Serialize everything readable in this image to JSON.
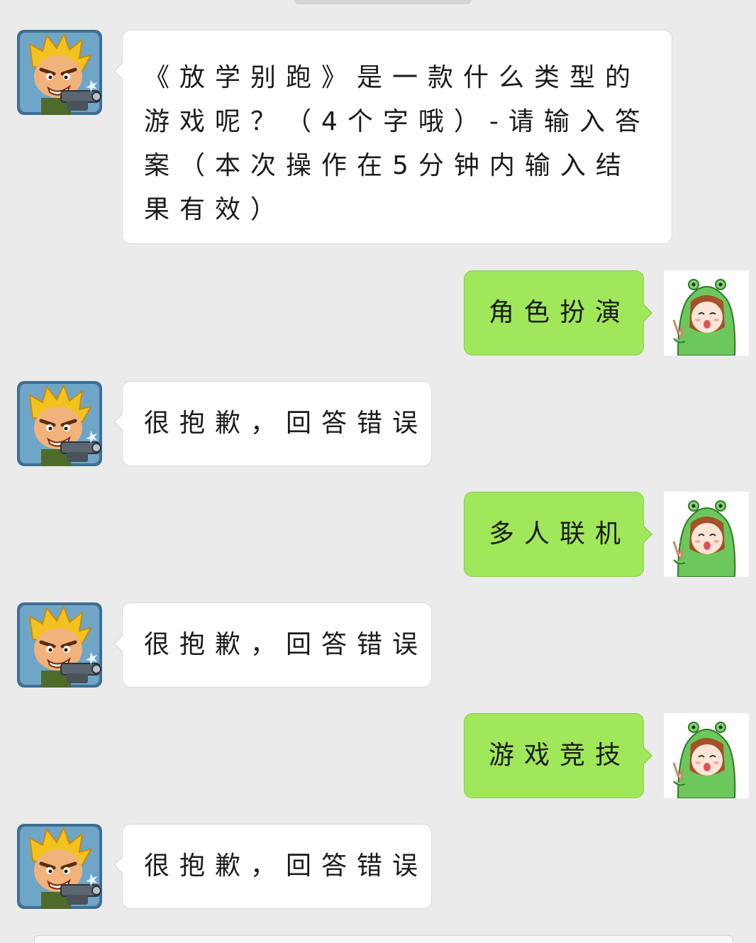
{
  "messages": [
    {
      "from": "bot",
      "text": "《放学别跑》是一款什么类型的游戏呢？（4个字哦）-请输入答案（本次操作在5分钟内输入结果有效）"
    },
    {
      "from": "user",
      "text": "角色扮演"
    },
    {
      "from": "bot",
      "text": "很抱歉，回答错误"
    },
    {
      "from": "user",
      "text": "多人联机"
    },
    {
      "from": "bot",
      "text": "很抱歉，回答错误"
    },
    {
      "from": "user",
      "text": "游戏竞技"
    },
    {
      "from": "bot",
      "text": "很抱歉，回答错误"
    }
  ],
  "avatars": {
    "bot": "game-character-avatar",
    "user": "green-hood-girl-avatar"
  },
  "colors": {
    "background": "#ebebeb",
    "incoming_bubble": "#ffffff",
    "outgoing_bubble": "#a0e75a"
  }
}
